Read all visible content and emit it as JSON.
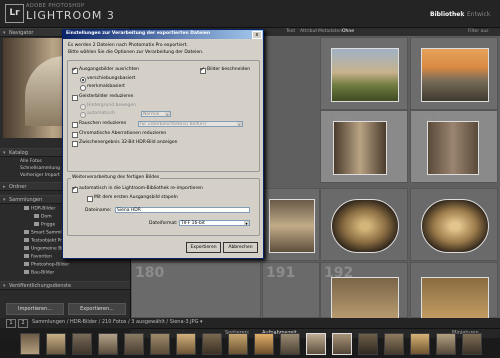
{
  "app": {
    "logo": "Lr",
    "brand_small": "ADOBE PHOTOSHOP",
    "brand_big": "LIGHTROOM 3",
    "modules": {
      "active": "Bibliothek",
      "sep": "|",
      "next": "Entwick"
    }
  },
  "left_panel": {
    "navigator": "Navigator",
    "catalog_head": "Katalog",
    "catalog_items": [
      "Alle Fotos",
      "Schnellsammlung +",
      "Vorheriger Import"
    ],
    "folders_head": "Ordner",
    "collections_head": "Sammlungen",
    "collections": [
      "HDR-Bilder",
      "Dom",
      "Prigge",
      "Smart Sammlungen",
      "Testsobjekt Prozeß",
      "Ungemeine Bilder",
      "Favoriten",
      "Photoshop-Bilder",
      "Bau-Bilder"
    ],
    "publish_head": "Veröffentlichungsdienste",
    "import_label": "Importieren...",
    "export_label": "Exportieren..."
  },
  "grid": {
    "filter_tabs": [
      "Text",
      "Attribut",
      "Metadaten",
      "Ohne"
    ],
    "filter_right": "Filter aus",
    "numbers": [
      "",
      "180",
      "",
      "191",
      "",
      "180",
      "191",
      "192"
    ],
    "sort_label": "Sortieren:",
    "sort_value": "Aufnahmezeit",
    "thumb_label": "Miniaturen"
  },
  "filmstrip": {
    "page1": "1",
    "page2": "2",
    "path": "Sammlungen / HDR-Bilder / 210 Fotos / 3 ausgewählt / Siena-3.JPG ▾"
  },
  "dialog": {
    "title": "Einstellungen zur Verarbeitung der exportierten Dateien",
    "close": "x",
    "intro_1": "Es werden 2 Dateien nach Photomatix Pro exportiert.",
    "intro_2": "Bitte wählen Sie die Optionen zur Verarbeitung der Dateien.",
    "align_label": "Ausgangsbilder ausrichten",
    "align_opt_1": "verschiebungsbasiert",
    "align_opt_2": "merkmalsbasiert",
    "ghost_label": "Geisterbilder reduzieren",
    "ghost_opt_1": "Hintergrund bewegen",
    "ghost_opt_2": "automatisch",
    "ghost_select": "Normal",
    "noise_label": "Rauschen reduzieren",
    "noise_select": "für unterbelichtete(s) Bild(er)",
    "chroma_label": "Chromatische Aberrationen reduzieren",
    "show_intermediate_label": "Zwischenergebnis 32-Bit HDR-Bild anzeigen",
    "show_images_label": "Bilder beschneiden",
    "group_label": "Weiterverarbeitung des fertigen Bildes",
    "reimport_label": "automatisch in die Lightroom-Bibliothek re-importieren",
    "stack_label": "Mit dem ersten Ausgangsbild stapeln",
    "filename_label": "Dateiname:",
    "filename_value": "Siena HDR",
    "format_label": "Dateiformat:",
    "format_value": "TIFF 16-bit",
    "export_btn": "Exportieren",
    "cancel_btn": "Abbrechen"
  }
}
